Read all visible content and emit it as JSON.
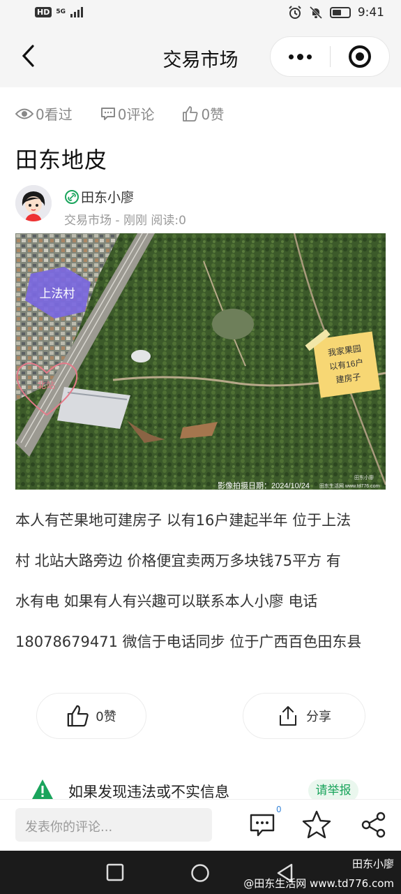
{
  "status_bar": {
    "network": "HD",
    "signal_label": "5G",
    "time": "9:41",
    "battery_level": 0.55
  },
  "nav": {
    "title": "交易市场"
  },
  "stats": {
    "views": "0看过",
    "comments": "0评论",
    "likes": "0赞"
  },
  "post": {
    "title": "田东地皮",
    "author_name": "田东小廖",
    "author_meta": "交易市场 - 刚刚 阅读:0",
    "body_lines": [
      "本人有芒果地可建房子 以有16户建起半年 位于上法",
      "村 北站大路旁边 价格便宜卖两万多块钱75平方 有",
      "水有电 如果有人有兴趣可以联系本人小廖 电话",
      "18078679471 微信于电话同步 位于广西百色田东县"
    ]
  },
  "photo": {
    "village_label": "上法村",
    "orchard_note_1": "我家果园",
    "orchard_note_2": "以有16户",
    "orchard_note_3": "建房子",
    "left_stamp": "北站",
    "capture_date": "影像拍摄日期：2024/10/24",
    "source_small": "田东小廖",
    "source_site": "田东生活网 www.td776.com"
  },
  "actions": {
    "like_label": "0赞",
    "share_label": "分享"
  },
  "report": {
    "text": "如果发现违法或不实信息",
    "button": "请举报"
  },
  "comment_bar": {
    "placeholder": "发表你的评论...",
    "comment_count": "0"
  },
  "watermark": {
    "line1": "田东小廖",
    "line2": "@田东生活网 www.td776.com"
  },
  "colors": {
    "accent_green": "#1aa45c",
    "badge_blue": "#3a86d8",
    "village_purple": "#7b68e0",
    "note_yellow": "#f7d774"
  }
}
